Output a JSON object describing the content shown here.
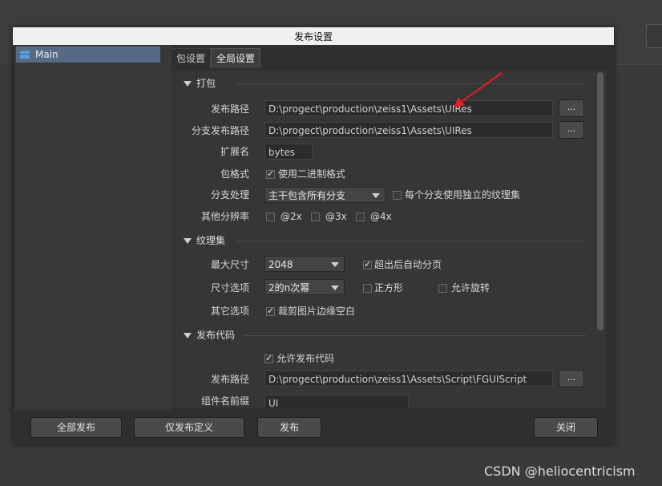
{
  "window": {
    "title": "发布设置"
  },
  "left_list": {
    "items": [
      {
        "label": "Main",
        "icon": "briefcase-icon"
      }
    ]
  },
  "tabs": [
    {
      "label": "包设置"
    },
    {
      "label": "全局设置"
    }
  ],
  "sections": {
    "pack": {
      "title": "打包",
      "publish_path_label": "发布路径",
      "publish_path_value": "D:\\progect\\production\\zeiss1\\Assets\\UIRes",
      "branch_path_label": "分支发布路径",
      "branch_path_value": "D:\\progect\\production\\zeiss1\\Assets\\UIRes",
      "ext_label": "扩展名",
      "ext_value": "bytes",
      "format_label": "包格式",
      "format_option": "使用二进制格式",
      "branch_label": "分支处理",
      "branch_select": "主干包含所有分支",
      "branch_option": "每个分支使用独立的纹理集",
      "res_label": "其他分辨率",
      "res_options": [
        "@2x",
        "@3x",
        "@4x"
      ],
      "browse": "..."
    },
    "atlas": {
      "title": "纹理集",
      "maxsize_label": "最大尺寸",
      "maxsize_value": "2048",
      "autopage_option": "超出后自动分页",
      "size_label": "尺寸选项",
      "size_value": "2的n次幂",
      "square_option": "正方形",
      "rotate_option": "允许旋转",
      "other_label": "其它选项",
      "trim_option": "裁剪图片边缘空白"
    },
    "code": {
      "title": "发布代码",
      "allow_option": "允许发布代码",
      "path_label": "发布路径",
      "path_value": "D:\\progect\\production\\zeiss1\\Assets\\Script\\FGUIScript",
      "browse": "...",
      "prefix_label": "组件名前缀",
      "prefix_value": "UI"
    }
  },
  "footer": {
    "publish_all": "全部发布",
    "publish_def": "仅发布定义",
    "publish": "发布",
    "close": "关闭"
  },
  "watermark": "CSDN @heliocentricism",
  "colors": {
    "accent": "#566a86",
    "annotation": "#e02020"
  }
}
